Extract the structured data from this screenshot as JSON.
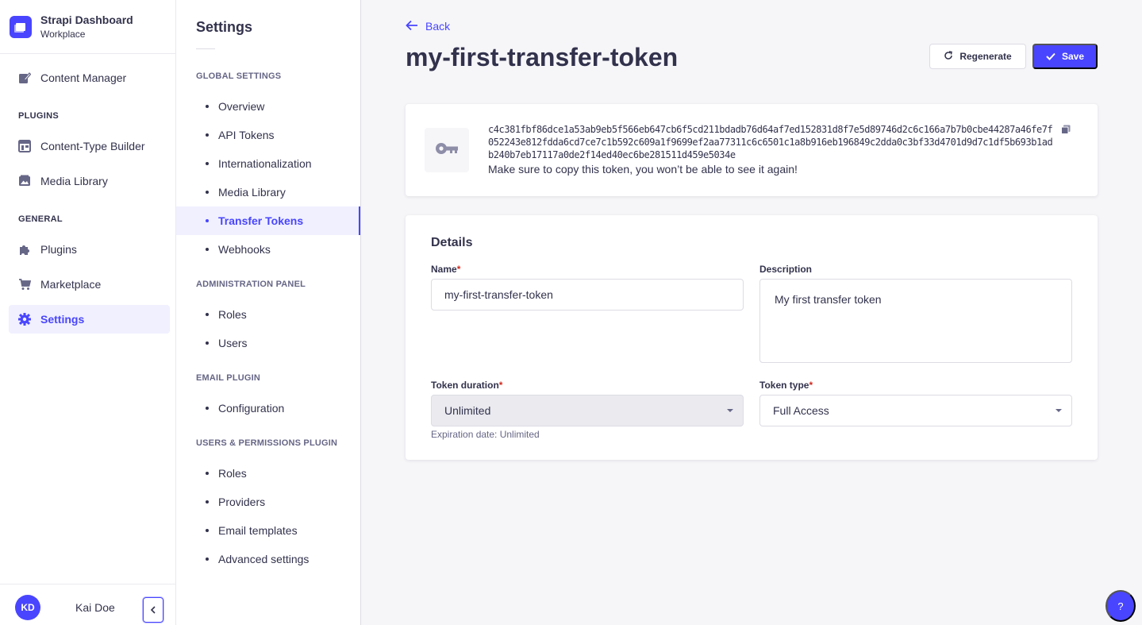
{
  "brand": {
    "title": "Strapi Dashboard",
    "subtitle": "Workplace"
  },
  "mainnav": {
    "content_manager": "Content Manager",
    "plugins_section": "PLUGINS",
    "content_type_builder": "Content-Type Builder",
    "media_library": "Media Library",
    "general_section": "GENERAL",
    "plugins": "Plugins",
    "marketplace": "Marketplace",
    "settings": "Settings"
  },
  "user": {
    "initials": "KD",
    "name": "Kai Doe"
  },
  "subnav": {
    "title": "Settings",
    "sections": [
      {
        "label": "GLOBAL SETTINGS",
        "items": [
          "Overview",
          "API Tokens",
          "Internationalization",
          "Media Library",
          "Transfer Tokens",
          "Webhooks"
        ]
      },
      {
        "label": "ADMINISTRATION PANEL",
        "items": [
          "Roles",
          "Users"
        ]
      },
      {
        "label": "EMAIL PLUGIN",
        "items": [
          "Configuration"
        ]
      },
      {
        "label": "USERS & PERMISSIONS PLUGIN",
        "items": [
          "Roles",
          "Providers",
          "Email templates",
          "Advanced settings"
        ]
      }
    ],
    "active_item": "Transfer Tokens"
  },
  "header": {
    "back_label": "Back",
    "title": "my-first-transfer-token",
    "regenerate_label": "Regenerate",
    "save_label": "Save"
  },
  "token": {
    "value": "c4c381fbf86dce1a53ab9eb5f566eb647cb6f5cd211bdadb76d64af7ed152831d8f7e5d89746d2c6c166a7b7b0cbe44287a46fe7f052243e812fdda6cd7ce7c1b592c609a1f9699ef2aa77311c6c6501c1a8b916eb196849c2dda0c3bf33d4701d9d7c1df5b693b1adb240b7eb17117a0de2f14ed40ec6be281511d459e5034e",
    "warning": "Make sure to copy this token, you won’t be able to see it again!"
  },
  "details": {
    "title": "Details",
    "name_label": "Name",
    "name_value": "my-first-transfer-token",
    "description_label": "Description",
    "description_value": "My first transfer token",
    "duration_label": "Token duration",
    "duration_value": "Unlimited",
    "expiration_hint": "Expiration date: Unlimited",
    "type_label": "Token type",
    "type_value": "Full Access",
    "required_marker": "*"
  },
  "help_button": "?",
  "colors": {
    "primary": "#4945ff",
    "danger": "#d02b20",
    "text": "#32324d",
    "muted": "#666687"
  }
}
